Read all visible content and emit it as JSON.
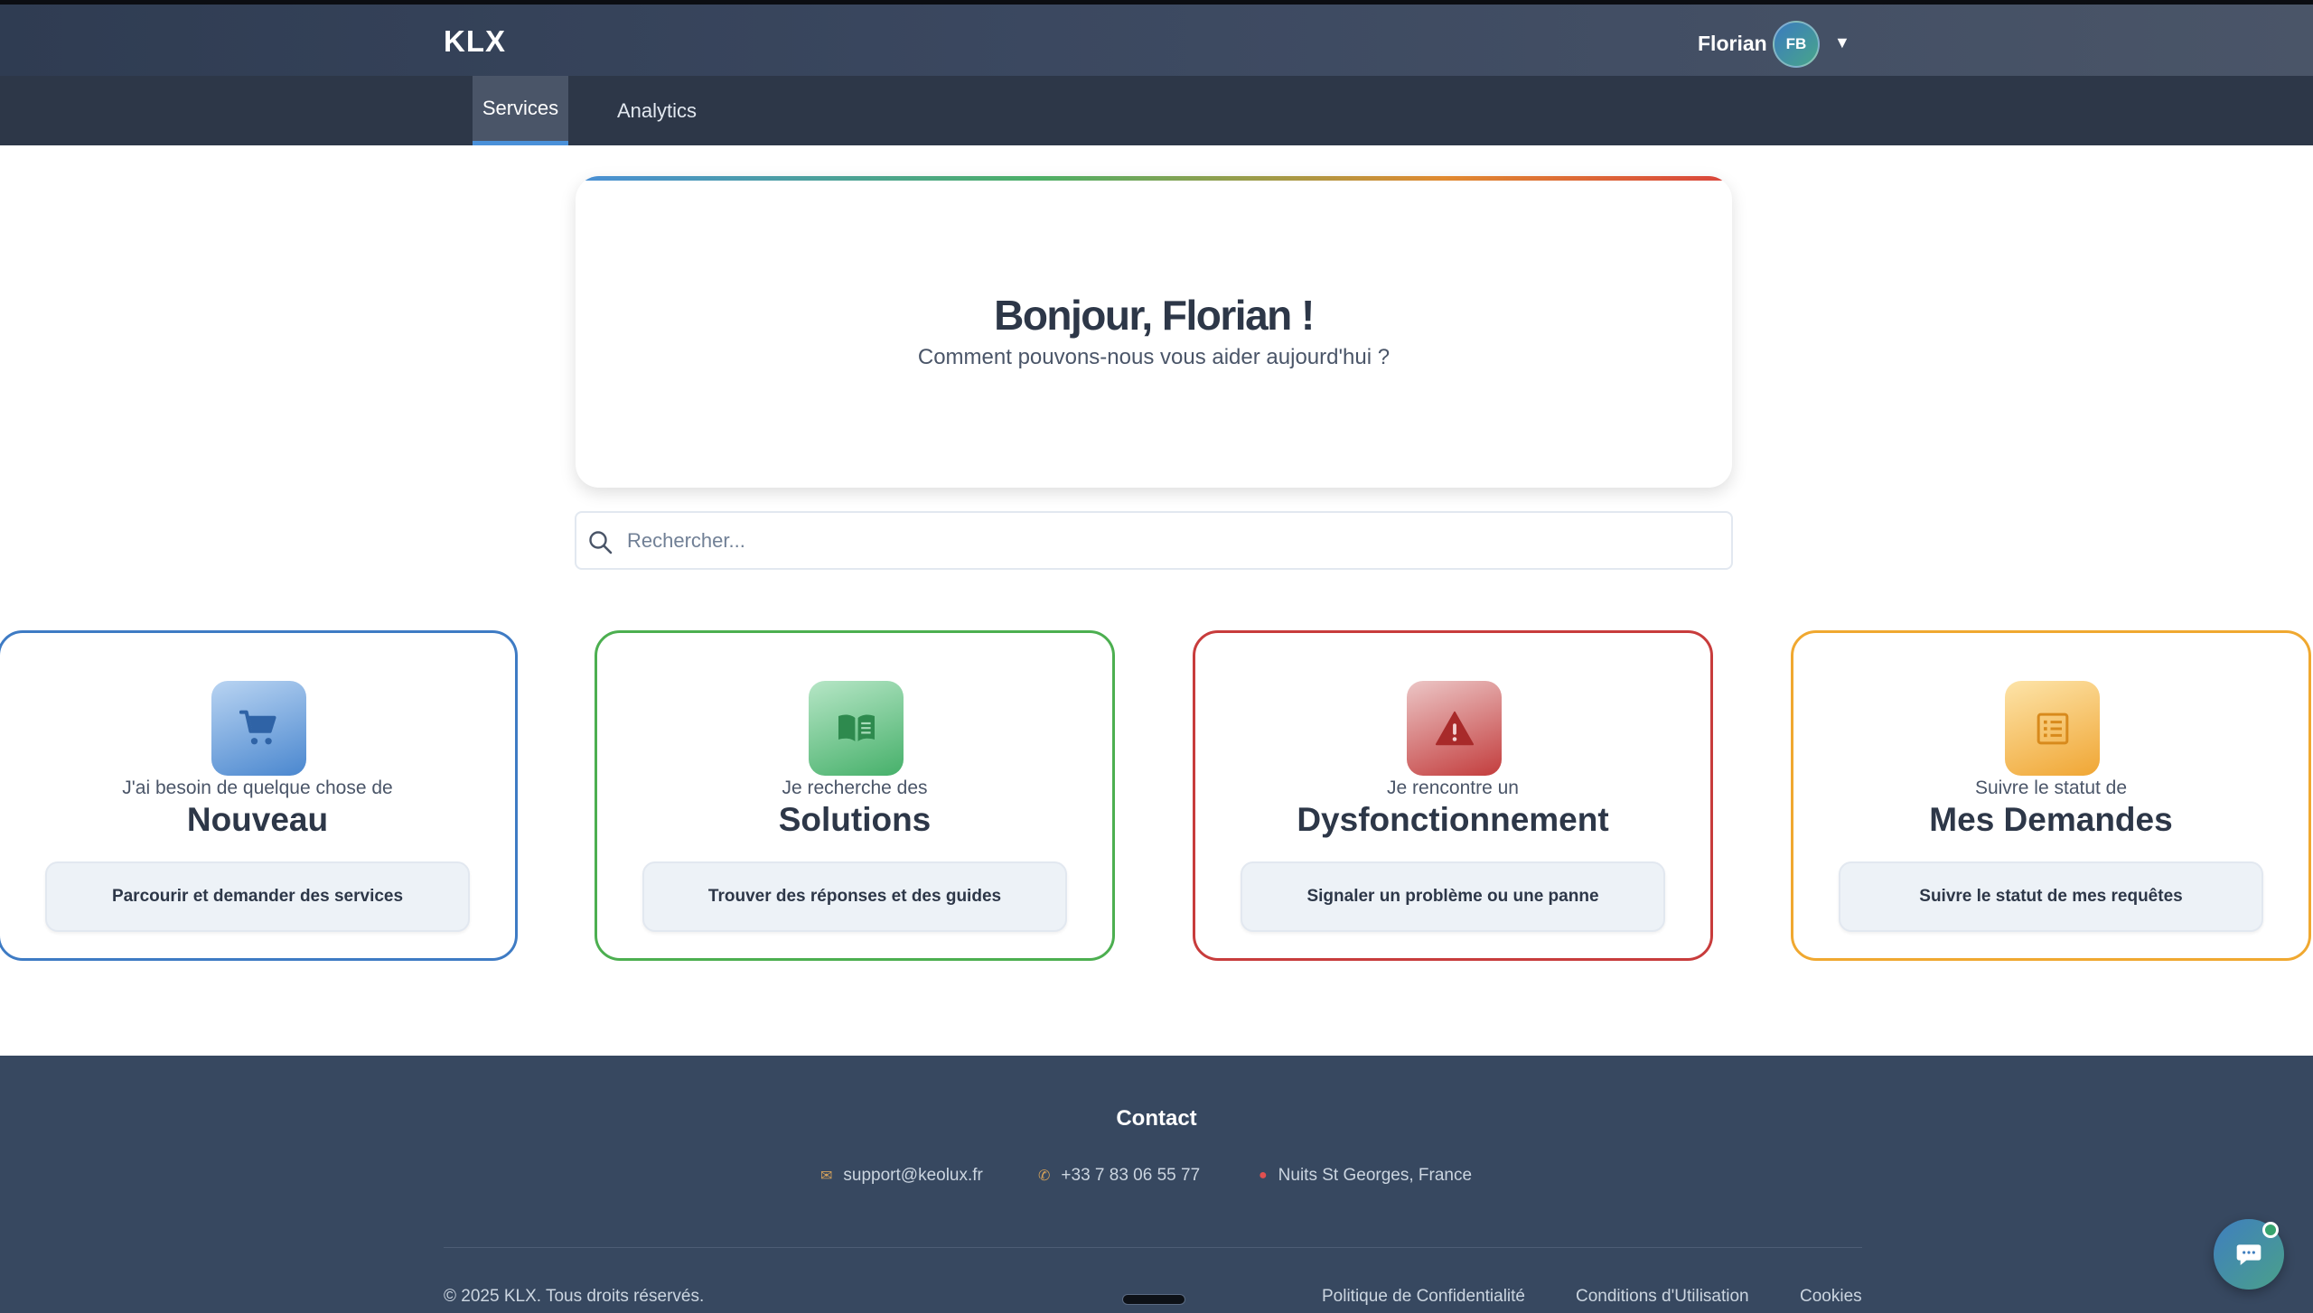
{
  "header": {
    "brand": "KLX",
    "user_name": "Florian",
    "avatar_initials": "FB",
    "menu_caret": "▼"
  },
  "nav": {
    "tabs": [
      {
        "label": "Services",
        "active": true
      },
      {
        "label": "Analytics",
        "active": false
      }
    ]
  },
  "welcome": {
    "title": "Bonjour, Florian !",
    "subtitle": "Comment pouvons-nous vous aider aujourd'hui ?"
  },
  "search": {
    "placeholder": "Rechercher...",
    "value": ""
  },
  "cards": [
    {
      "icon": "cart-icon",
      "color": "#3e7bc4",
      "subtitle": "J'ai besoin de quelque chose de",
      "title": "Nouveau",
      "button": "Parcourir et demander des services"
    },
    {
      "icon": "book-icon",
      "color": "#4caf50",
      "subtitle": "Je recherche des",
      "title": "Solutions",
      "button": "Trouver des réponses et des guides"
    },
    {
      "icon": "warning-icon",
      "color": "#c83c3c",
      "subtitle": "Je rencontre un",
      "title": "Dysfonctionnement",
      "button": "Signaler un problème ou une panne"
    },
    {
      "icon": "list-icon",
      "color": "#f0a830",
      "subtitle": "Suivre le statut de",
      "title": "Mes Demandes",
      "button": "Suivre le statut de mes requêtes"
    }
  ],
  "footer": {
    "contact_title": "Contact",
    "email": "support@keolux.fr",
    "phone": "+33 7 83 06 55 77",
    "address": "Nuits St Georges, France",
    "copyright": "© 2025 KLX. Tous droits réservés.",
    "links": [
      "Politique de Confidentialité",
      "Conditions d'Utilisation",
      "Cookies"
    ]
  },
  "colors": {
    "header_bg": "#3b4860",
    "nav_bg": "#2d3748",
    "footer_bg": "#374860",
    "accent": "#4a90d9"
  }
}
